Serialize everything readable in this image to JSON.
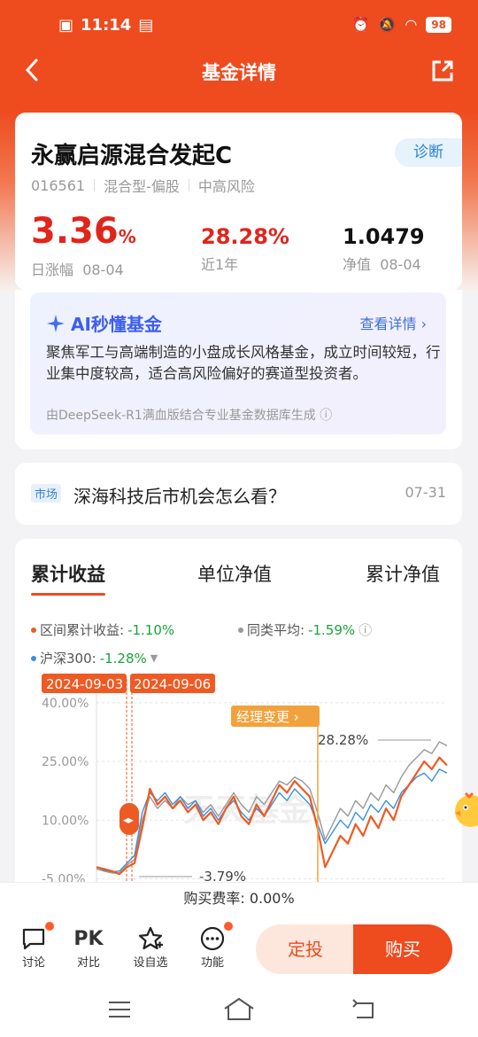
{
  "status": {
    "time": "11:14",
    "battery": "98"
  },
  "nav": {
    "title": "基金详情"
  },
  "fund": {
    "name": "永赢启源混合发起C",
    "diagnose_label": "诊断",
    "code": "016561",
    "type": "混合型-偏股",
    "risk": "中高风险",
    "daily_change": "3.36",
    "daily_change_unit": "%",
    "daily_label": "日涨幅",
    "daily_date": "08-04",
    "year_return": "28.28%",
    "year_label": "近1年",
    "nav_value": "1.0479",
    "nav_label": "净值",
    "nav_date": "08-04"
  },
  "ai": {
    "title": "AI秒懂基金",
    "more": "查看详情",
    "text": "聚焦军工与高端制造的小盘成长风格基金，成立时间较短，行业集中度较高，适合高风险偏好的赛道型投资者。",
    "footer": "由DeepSeek-R1满血版结合专业基金数据库生成"
  },
  "news": {
    "tag": "市场",
    "title": "深海科技后市机会怎么看？",
    "date": "07-31"
  },
  "chart": {
    "tabs": [
      "累计收益",
      "单位净值",
      "累计净值"
    ],
    "legend": {
      "fund_label": "区间累计收益:",
      "fund_value": "-1.10%",
      "peer_label": "同类平均:",
      "peer_value": "-1.59%",
      "index_label": "沪深300:",
      "index_value": "-1.28%"
    },
    "date_tag_1": "2024-09-03",
    "date_tag_2": "2024-09-06",
    "manager_change": "经理变更",
    "high_label": "28.28%",
    "low_label": "-3.79%",
    "watermark": "天天基金",
    "colors": {
      "fund": "#ee5a24",
      "peer": "#999999",
      "index": "#3a8fe0",
      "green": "#1aa33a"
    }
  },
  "chart_data": {
    "type": "line",
    "ylim": [
      -6,
      42
    ],
    "yticks": [
      "40.00%",
      "25.00%",
      "10.00%",
      "-5.00%"
    ],
    "series": [
      {
        "name": "区间累计收益",
        "values": [
          -2,
          -2.5,
          -3,
          -3.79,
          -2,
          -1,
          8,
          18,
          14,
          16,
          13,
          15,
          12,
          14,
          10,
          12,
          9,
          13,
          16,
          11,
          9,
          14,
          11,
          15,
          19,
          17,
          20,
          18,
          16,
          8,
          -2,
          2,
          6,
          4,
          9,
          6,
          11,
          8,
          13,
          10,
          16,
          19,
          22,
          25,
          23,
          26,
          24
        ]
      },
      {
        "name": "同类平均",
        "values": [
          -2.5,
          -3,
          -3.5,
          -3.5,
          -1.5,
          0,
          10,
          16,
          13,
          15,
          13,
          16,
          14,
          15,
          12,
          14,
          11,
          14,
          17,
          14,
          12,
          16,
          14,
          17,
          20,
          19,
          21,
          20,
          18,
          12,
          5,
          9,
          13,
          11,
          15,
          13,
          17,
          15,
          19,
          17,
          21,
          24,
          26,
          28,
          27,
          30,
          29
        ]
      },
      {
        "name": "沪深300",
        "values": [
          -2,
          -2.8,
          -3.2,
          -3,
          -1,
          1,
          12,
          17,
          15,
          17,
          14,
          16,
          13,
          15,
          11,
          13,
          10,
          13,
          15,
          12,
          10,
          13,
          11,
          14,
          17,
          15,
          18,
          16,
          14,
          9,
          4,
          7,
          10,
          8,
          12,
          10,
          14,
          12,
          15,
          13,
          17,
          19,
          21,
          22,
          20,
          23,
          22
        ]
      }
    ]
  },
  "fee": {
    "text": "购买费率: 0.00%"
  },
  "actions": {
    "discuss": "讨论",
    "pk_icon": "PK",
    "compare": "对比",
    "favorite": "设自选",
    "function": "功能",
    "fixed_invest": "定投",
    "buy": "购买"
  }
}
